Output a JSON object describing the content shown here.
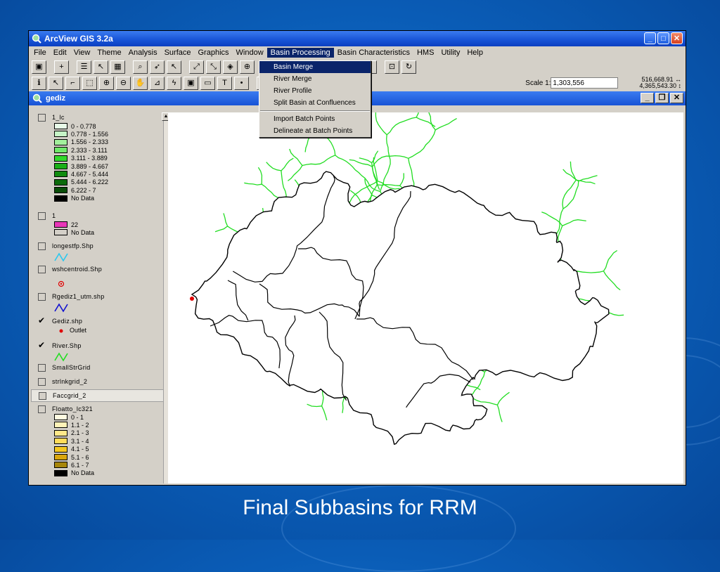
{
  "window": {
    "title": "ArcView GIS 3.2a"
  },
  "menu": [
    "File",
    "Edit",
    "View",
    "Theme",
    "Analysis",
    "Surface",
    "Graphics",
    "Window",
    "Basin Processing",
    "Basin Characteristics",
    "HMS",
    "Utility",
    "Help"
  ],
  "dropdown": {
    "items": [
      "Basin Merge",
      "River Merge",
      "River Profile",
      "Split Basin at Confluences",
      "Import Batch Points",
      "Delineate at Batch Points"
    ]
  },
  "scale": {
    "label": "Scale 1:",
    "value": "1,303,556",
    "x": "516,668.91",
    "y": "4,365,543.30"
  },
  "view": {
    "title": "gediz"
  },
  "toc": {
    "themes": [
      {
        "name": "1_lc",
        "checked": false,
        "legend": [
          {
            "label": "0 - 0.778",
            "color": "#e8fbe8"
          },
          {
            "label": "0.778 - 1.556",
            "color": "#c6f4c6"
          },
          {
            "label": "1.556 - 2.333",
            "color": "#a2ef9c"
          },
          {
            "label": "2.333 - 3.111",
            "color": "#6fe86a"
          },
          {
            "label": "3.111 - 3.889",
            "color": "#31d92c"
          },
          {
            "label": "3.889 - 4.667",
            "color": "#1aaf17"
          },
          {
            "label": "4.667 - 5.444",
            "color": "#118c10"
          },
          {
            "label": "5.444 - 6.222",
            "color": "#0c6b0b"
          },
          {
            "label": "6.222 - 7",
            "color": "#094d08"
          },
          {
            "label": "No Data",
            "color": "#000000"
          }
        ]
      },
      {
        "name": "1",
        "checked": false,
        "legend": [
          {
            "label": "22",
            "color": "#e936b8"
          },
          {
            "label": "No Data",
            "color": "#d4d0c8"
          }
        ]
      },
      {
        "name": "longestfp.Shp",
        "checked": false
      },
      {
        "name": "wshcentroid.Shp",
        "checked": false
      },
      {
        "name": "Rgediz1_utm.shp",
        "checked": false
      },
      {
        "name": "Gediz.shp",
        "checked": true,
        "legend_label": "Outlet"
      },
      {
        "name": "River.Shp",
        "checked": true
      },
      {
        "name": "SmallStrGrid",
        "checked": false
      },
      {
        "name": "strlnkgrid_2",
        "checked": false
      },
      {
        "name": "Faccgrid_2",
        "checked": false
      },
      {
        "name": "Floatto_lc321",
        "checked": false,
        "legend": [
          {
            "label": "0 - 1",
            "color": "#fffbe0"
          },
          {
            "label": "1.1 - 2",
            "color": "#fff3b8"
          },
          {
            "label": "2.1 - 3",
            "color": "#ffe98a"
          },
          {
            "label": "3.1 - 4",
            "color": "#ffdc5a"
          },
          {
            "label": "4.1 - 5",
            "color": "#f4c720"
          },
          {
            "label": "5.1 - 6",
            "color": "#d9a60c"
          },
          {
            "label": "6.1 - 7",
            "color": "#a7860a"
          },
          {
            "label": "No Data",
            "color": "#000000"
          }
        ]
      }
    ]
  },
  "caption": "Final Subbasins for RRM",
  "colors": {
    "river": "#22dd22",
    "boundary": "#000000",
    "outlet": "#e00000"
  }
}
